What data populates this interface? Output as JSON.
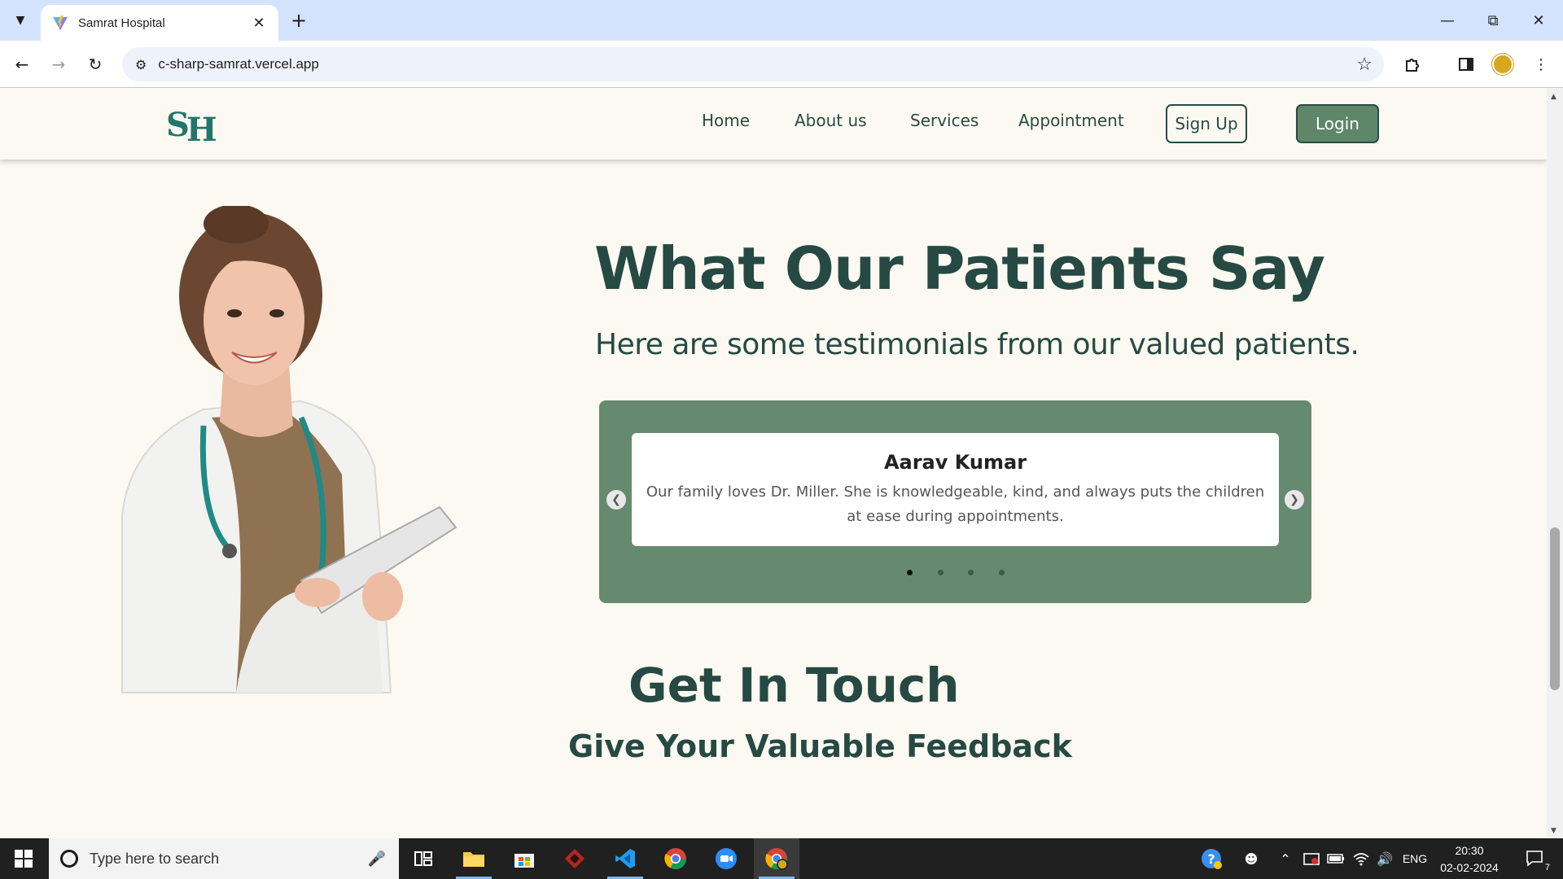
{
  "browser": {
    "tab_title": "Samrat Hospital",
    "url": "c-sharp-samrat.vercel.app"
  },
  "site": {
    "logo": "SH",
    "nav": {
      "home": "Home",
      "about": "About us",
      "services": "Services",
      "appointment": "Appointment",
      "signup": "Sign Up",
      "login": "Login"
    },
    "testimonials": {
      "heading": "What Our Patients Say",
      "subheading": "Here are some testimonials from our valued patients.",
      "current": {
        "name": "Aarav Kumar",
        "text": "Our family loves Dr. Miller. She is knowledgeable, kind, and always puts the children at ease during appointments."
      },
      "slide_count": 4,
      "active_slide": 1
    },
    "contact": {
      "heading": "Get In Touch",
      "subheading": "Give Your Valuable Feedback"
    }
  },
  "taskbar": {
    "search_placeholder": "Type here to search",
    "language": "ENG",
    "time": "20:30",
    "date": "02-02-2024",
    "notification_count": "7"
  },
  "colors": {
    "brand_dark": "#264a43",
    "brand_green": "#5e8769",
    "carousel_bg": "#668a6f",
    "page_bg": "#fbf9f1"
  }
}
